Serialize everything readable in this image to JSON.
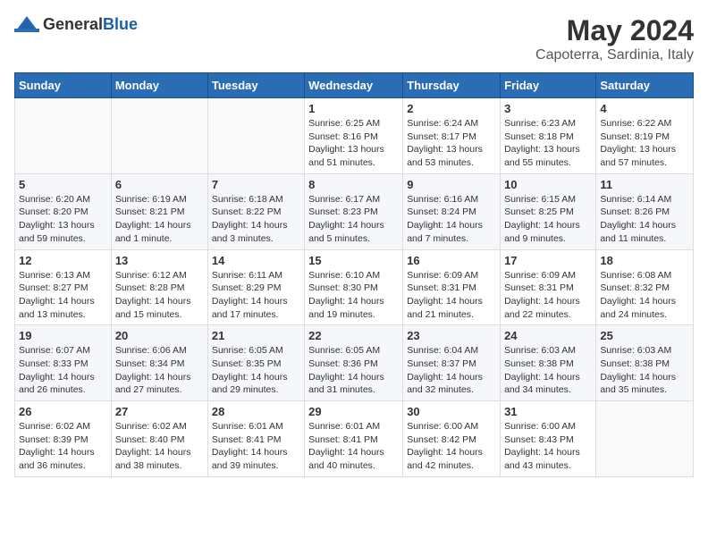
{
  "header": {
    "logo_general": "General",
    "logo_blue": "Blue",
    "main_title": "May 2024",
    "subtitle": "Capoterra, Sardinia, Italy"
  },
  "columns": [
    "Sunday",
    "Monday",
    "Tuesday",
    "Wednesday",
    "Thursday",
    "Friday",
    "Saturday"
  ],
  "weeks": [
    [
      {
        "day": "",
        "sunrise": "",
        "sunset": "",
        "daylight": ""
      },
      {
        "day": "",
        "sunrise": "",
        "sunset": "",
        "daylight": ""
      },
      {
        "day": "",
        "sunrise": "",
        "sunset": "",
        "daylight": ""
      },
      {
        "day": "1",
        "sunrise": "Sunrise: 6:25 AM",
        "sunset": "Sunset: 8:16 PM",
        "daylight": "Daylight: 13 hours and 51 minutes."
      },
      {
        "day": "2",
        "sunrise": "Sunrise: 6:24 AM",
        "sunset": "Sunset: 8:17 PM",
        "daylight": "Daylight: 13 hours and 53 minutes."
      },
      {
        "day": "3",
        "sunrise": "Sunrise: 6:23 AM",
        "sunset": "Sunset: 8:18 PM",
        "daylight": "Daylight: 13 hours and 55 minutes."
      },
      {
        "day": "4",
        "sunrise": "Sunrise: 6:22 AM",
        "sunset": "Sunset: 8:19 PM",
        "daylight": "Daylight: 13 hours and 57 minutes."
      }
    ],
    [
      {
        "day": "5",
        "sunrise": "Sunrise: 6:20 AM",
        "sunset": "Sunset: 8:20 PM",
        "daylight": "Daylight: 13 hours and 59 minutes."
      },
      {
        "day": "6",
        "sunrise": "Sunrise: 6:19 AM",
        "sunset": "Sunset: 8:21 PM",
        "daylight": "Daylight: 14 hours and 1 minute."
      },
      {
        "day": "7",
        "sunrise": "Sunrise: 6:18 AM",
        "sunset": "Sunset: 8:22 PM",
        "daylight": "Daylight: 14 hours and 3 minutes."
      },
      {
        "day": "8",
        "sunrise": "Sunrise: 6:17 AM",
        "sunset": "Sunset: 8:23 PM",
        "daylight": "Daylight: 14 hours and 5 minutes."
      },
      {
        "day": "9",
        "sunrise": "Sunrise: 6:16 AM",
        "sunset": "Sunset: 8:24 PM",
        "daylight": "Daylight: 14 hours and 7 minutes."
      },
      {
        "day": "10",
        "sunrise": "Sunrise: 6:15 AM",
        "sunset": "Sunset: 8:25 PM",
        "daylight": "Daylight: 14 hours and 9 minutes."
      },
      {
        "day": "11",
        "sunrise": "Sunrise: 6:14 AM",
        "sunset": "Sunset: 8:26 PM",
        "daylight": "Daylight: 14 hours and 11 minutes."
      }
    ],
    [
      {
        "day": "12",
        "sunrise": "Sunrise: 6:13 AM",
        "sunset": "Sunset: 8:27 PM",
        "daylight": "Daylight: 14 hours and 13 minutes."
      },
      {
        "day": "13",
        "sunrise": "Sunrise: 6:12 AM",
        "sunset": "Sunset: 8:28 PM",
        "daylight": "Daylight: 14 hours and 15 minutes."
      },
      {
        "day": "14",
        "sunrise": "Sunrise: 6:11 AM",
        "sunset": "Sunset: 8:29 PM",
        "daylight": "Daylight: 14 hours and 17 minutes."
      },
      {
        "day": "15",
        "sunrise": "Sunrise: 6:10 AM",
        "sunset": "Sunset: 8:30 PM",
        "daylight": "Daylight: 14 hours and 19 minutes."
      },
      {
        "day": "16",
        "sunrise": "Sunrise: 6:09 AM",
        "sunset": "Sunset: 8:31 PM",
        "daylight": "Daylight: 14 hours and 21 minutes."
      },
      {
        "day": "17",
        "sunrise": "Sunrise: 6:09 AM",
        "sunset": "Sunset: 8:31 PM",
        "daylight": "Daylight: 14 hours and 22 minutes."
      },
      {
        "day": "18",
        "sunrise": "Sunrise: 6:08 AM",
        "sunset": "Sunset: 8:32 PM",
        "daylight": "Daylight: 14 hours and 24 minutes."
      }
    ],
    [
      {
        "day": "19",
        "sunrise": "Sunrise: 6:07 AM",
        "sunset": "Sunset: 8:33 PM",
        "daylight": "Daylight: 14 hours and 26 minutes."
      },
      {
        "day": "20",
        "sunrise": "Sunrise: 6:06 AM",
        "sunset": "Sunset: 8:34 PM",
        "daylight": "Daylight: 14 hours and 27 minutes."
      },
      {
        "day": "21",
        "sunrise": "Sunrise: 6:05 AM",
        "sunset": "Sunset: 8:35 PM",
        "daylight": "Daylight: 14 hours and 29 minutes."
      },
      {
        "day": "22",
        "sunrise": "Sunrise: 6:05 AM",
        "sunset": "Sunset: 8:36 PM",
        "daylight": "Daylight: 14 hours and 31 minutes."
      },
      {
        "day": "23",
        "sunrise": "Sunrise: 6:04 AM",
        "sunset": "Sunset: 8:37 PM",
        "daylight": "Daylight: 14 hours and 32 minutes."
      },
      {
        "day": "24",
        "sunrise": "Sunrise: 6:03 AM",
        "sunset": "Sunset: 8:38 PM",
        "daylight": "Daylight: 14 hours and 34 minutes."
      },
      {
        "day": "25",
        "sunrise": "Sunrise: 6:03 AM",
        "sunset": "Sunset: 8:38 PM",
        "daylight": "Daylight: 14 hours and 35 minutes."
      }
    ],
    [
      {
        "day": "26",
        "sunrise": "Sunrise: 6:02 AM",
        "sunset": "Sunset: 8:39 PM",
        "daylight": "Daylight: 14 hours and 36 minutes."
      },
      {
        "day": "27",
        "sunrise": "Sunrise: 6:02 AM",
        "sunset": "Sunset: 8:40 PM",
        "daylight": "Daylight: 14 hours and 38 minutes."
      },
      {
        "day": "28",
        "sunrise": "Sunrise: 6:01 AM",
        "sunset": "Sunset: 8:41 PM",
        "daylight": "Daylight: 14 hours and 39 minutes."
      },
      {
        "day": "29",
        "sunrise": "Sunrise: 6:01 AM",
        "sunset": "Sunset: 8:41 PM",
        "daylight": "Daylight: 14 hours and 40 minutes."
      },
      {
        "day": "30",
        "sunrise": "Sunrise: 6:00 AM",
        "sunset": "Sunset: 8:42 PM",
        "daylight": "Daylight: 14 hours and 42 minutes."
      },
      {
        "day": "31",
        "sunrise": "Sunrise: 6:00 AM",
        "sunset": "Sunset: 8:43 PM",
        "daylight": "Daylight: 14 hours and 43 minutes."
      },
      {
        "day": "",
        "sunrise": "",
        "sunset": "",
        "daylight": ""
      }
    ]
  ]
}
